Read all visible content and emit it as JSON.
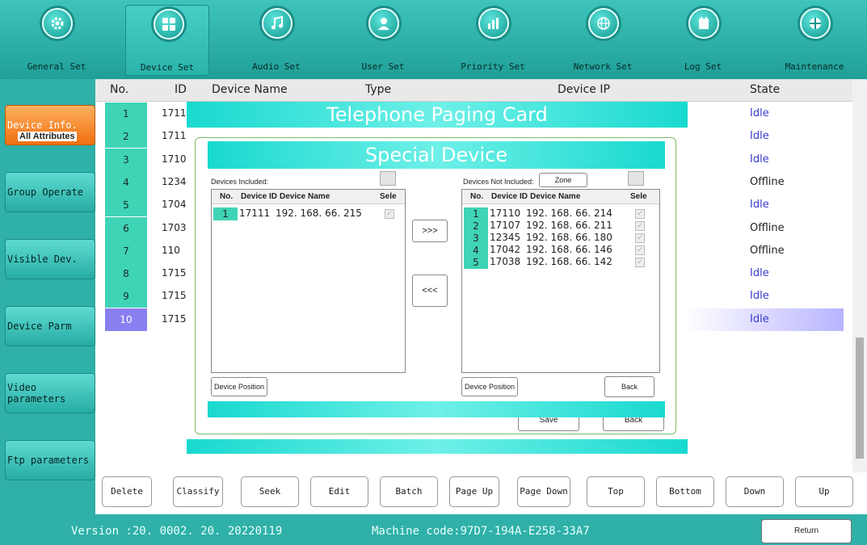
{
  "toolbar": {
    "items": [
      {
        "label": "General Set",
        "icon": "gear-icon"
      },
      {
        "label": "Device Set",
        "icon": "device-icon"
      },
      {
        "label": "Audio Set",
        "icon": "music-icon"
      },
      {
        "label": "User Set",
        "icon": "user-icon"
      },
      {
        "label": "Priority Set",
        "icon": "priority-icon"
      },
      {
        "label": "Network Set",
        "icon": "globe-icon"
      },
      {
        "label": "Log  Set",
        "icon": "log-icon"
      },
      {
        "label": "Maintenance",
        "icon": "maintenance-icon"
      }
    ],
    "active": "Device Set"
  },
  "leftnav": {
    "items": [
      "Device Info.",
      "Group Operate",
      "Visible Dev.",
      "Device Parm",
      "Video parameters",
      "Ftp parameters"
    ],
    "active": "Device Info."
  },
  "table": {
    "headers": {
      "no": "No.",
      "id": "ID",
      "name": "Device Name",
      "type": "Type",
      "ip": "Device IP",
      "state": "State"
    },
    "rows": [
      {
        "no": "1",
        "id": "1711",
        "state": "Idle"
      },
      {
        "no": "2",
        "id": "1711",
        "state": "Idle"
      },
      {
        "no": "3",
        "id": "1710",
        "state": "Idle"
      },
      {
        "no": "4",
        "id": "1234",
        "state": "Offline"
      },
      {
        "no": "5",
        "id": "1704",
        "state": "Idle"
      },
      {
        "no": "6",
        "id": "1703",
        "state": "Offline"
      },
      {
        "no": "7",
        "id": "110",
        "state": "Offline"
      },
      {
        "no": "8",
        "id": "1715",
        "state": "Idle"
      },
      {
        "no": "9",
        "id": "1715",
        "state": "Idle"
      },
      {
        "no": "10",
        "id": "1715",
        "state": "Idle"
      }
    ],
    "selected_row": 10
  },
  "outer_dialog": {
    "title": "Telephone Paging Card",
    "group_title": "All Attributes",
    "save": "Save",
    "back": "Back"
  },
  "special_dialog": {
    "title": "Special Device",
    "included_label": "Devices Included:",
    "not_included_label": "Devices Not Included:",
    "zone_button": "Zone",
    "col_no": "No.",
    "col_id": "Device ID",
    "col_name": "Device Name",
    "col_select": "Sele",
    "included": [
      {
        "no": "1",
        "id": "17111",
        "name": "192. 168. 66. 215"
      }
    ],
    "not_included": [
      {
        "no": "1",
        "id": "17110",
        "name": "192. 168. 66. 214"
      },
      {
        "no": "2",
        "id": "17107",
        "name": "192. 168. 66. 211"
      },
      {
        "no": "3",
        "id": "12345",
        "name": "192. 168. 66. 180"
      },
      {
        "no": "4",
        "id": "17042",
        "name": "192. 168. 66. 146"
      },
      {
        "no": "5",
        "id": "17038",
        "name": "192. 168. 66. 142"
      }
    ],
    "move_right": ">>>",
    "move_left": "<<<",
    "device_position": "Device Position",
    "back": "Back"
  },
  "buttons": [
    "Delete",
    "Classify",
    "Seek",
    "Edit",
    "Batch",
    "Page Up",
    "Page Down",
    "Top",
    "Bottom",
    "Down",
    "Up"
  ],
  "status": {
    "version": "Version :20. 0002. 20. 20220119",
    "machine_code": "Machine code:97D7-194A-E258-33A7",
    "return": "Return"
  },
  "colors": {
    "teal": "#2fb0a8",
    "accent_orange": "#f07010",
    "idle": "#3a3ad0",
    "row_no": "#3fd4b6"
  }
}
